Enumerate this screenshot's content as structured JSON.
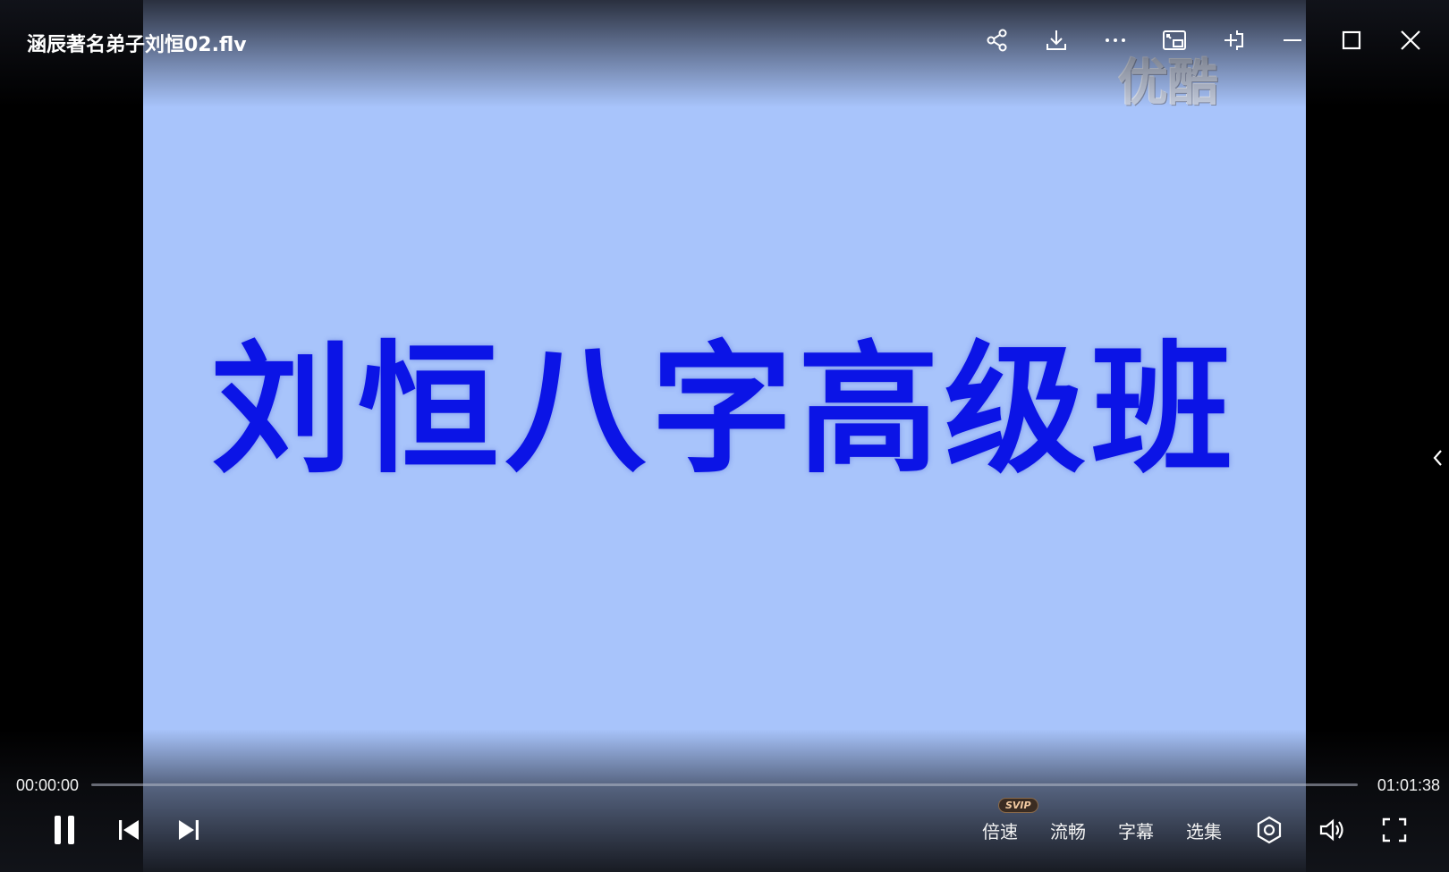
{
  "window": {
    "title": "涵辰著名弟子刘恒02.flv"
  },
  "video": {
    "frame_text": "刘恒八字高级班",
    "watermark_text": "优酷",
    "background_color": "#a8c4fb",
    "text_color": "#0b14e6"
  },
  "top_bar": {
    "icons": [
      "share-icon",
      "download-icon",
      "more-icon",
      "picture-in-picture-icon",
      "pin-on-top-icon",
      "minimize-icon",
      "maximize-icon",
      "close-icon"
    ]
  },
  "playback": {
    "current_time": "00:00:00",
    "total_time": "01:01:38",
    "progress_fraction": 0,
    "state": "playing"
  },
  "controls": {
    "speed_label": "倍速",
    "svip_badge": "SVIP",
    "quality_label": "流畅",
    "subtitle_label": "字幕",
    "episodes_label": "选集"
  },
  "colors": {
    "accent": "#3b86ff"
  }
}
